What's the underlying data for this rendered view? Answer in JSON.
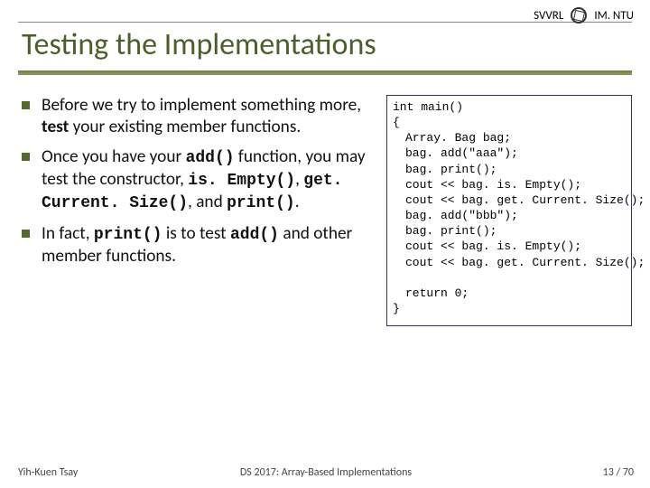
{
  "header": {
    "lab": "SVVRL",
    "org": "IM. NTU"
  },
  "title": "Testing the Implementations",
  "bullets": [
    {
      "pre": "Before we try to implement something more, ",
      "bold1": "test",
      "post1": " your existing member functions."
    },
    {
      "pre": "Once you have your ",
      "mono1": "add()",
      "mid1": " function, you may test the constructor, ",
      "mono2": "is. Empty()",
      "mid2": ", ",
      "mono3": "get. Current. Size()",
      "mid3": ", and ",
      "mono4": "print()",
      "post": "."
    },
    {
      "pre": "In fact, ",
      "mono1": "print()",
      "mid1": " is to test ",
      "mono2": "add()",
      "post": " and other member functions."
    }
  ],
  "code": {
    "l1": "int main()",
    "l2": "{",
    "l3": "Array. Bag bag;",
    "l4": "bag. add(\"aaa\");",
    "l5": "bag. print();",
    "l6": "cout << bag. is. Empty();",
    "l7": "cout << bag. get. Current. Size();",
    "l8": "bag. add(\"bbb\");",
    "l9": "bag. print();",
    "l10": "cout << bag. is. Empty();",
    "l11": "cout << bag. get. Current. Size();",
    "blank": "",
    "l12": "return 0;",
    "l13": "}"
  },
  "footer": {
    "left": "Yih-Kuen Tsay",
    "center": "DS 2017: Array-Based Implementations",
    "right": "13 / 70"
  }
}
